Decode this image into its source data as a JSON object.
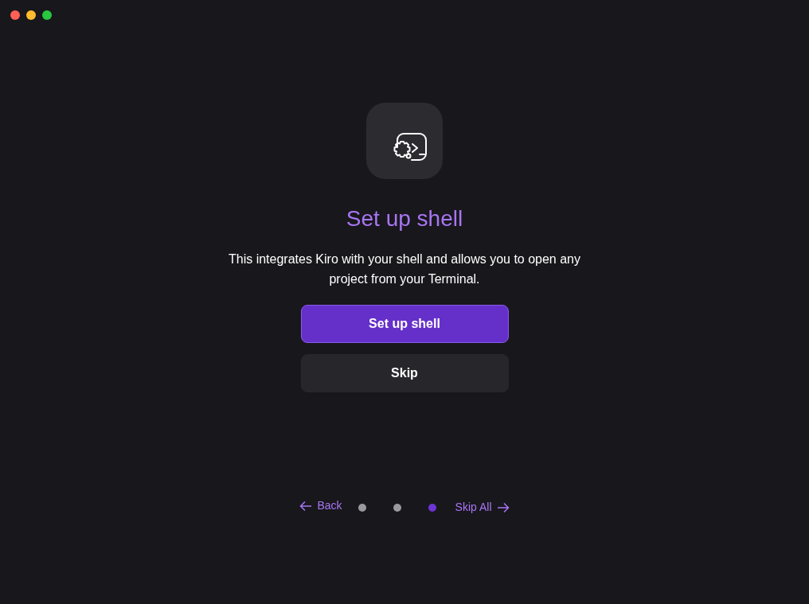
{
  "title": "Set up shell",
  "description": "This integrates Kiro with your shell and allows you to open any project from your Terminal.",
  "buttons": [
    {
      "label": "Set up shell",
      "kind": "primary"
    },
    {
      "label": "Skip",
      "kind": "secondary"
    }
  ],
  "navigation": {
    "back": "Back",
    "skip_all": "Skip All",
    "steps": [
      {
        "selected": false
      },
      {
        "selected": false
      },
      {
        "selected": true
      }
    ]
  }
}
